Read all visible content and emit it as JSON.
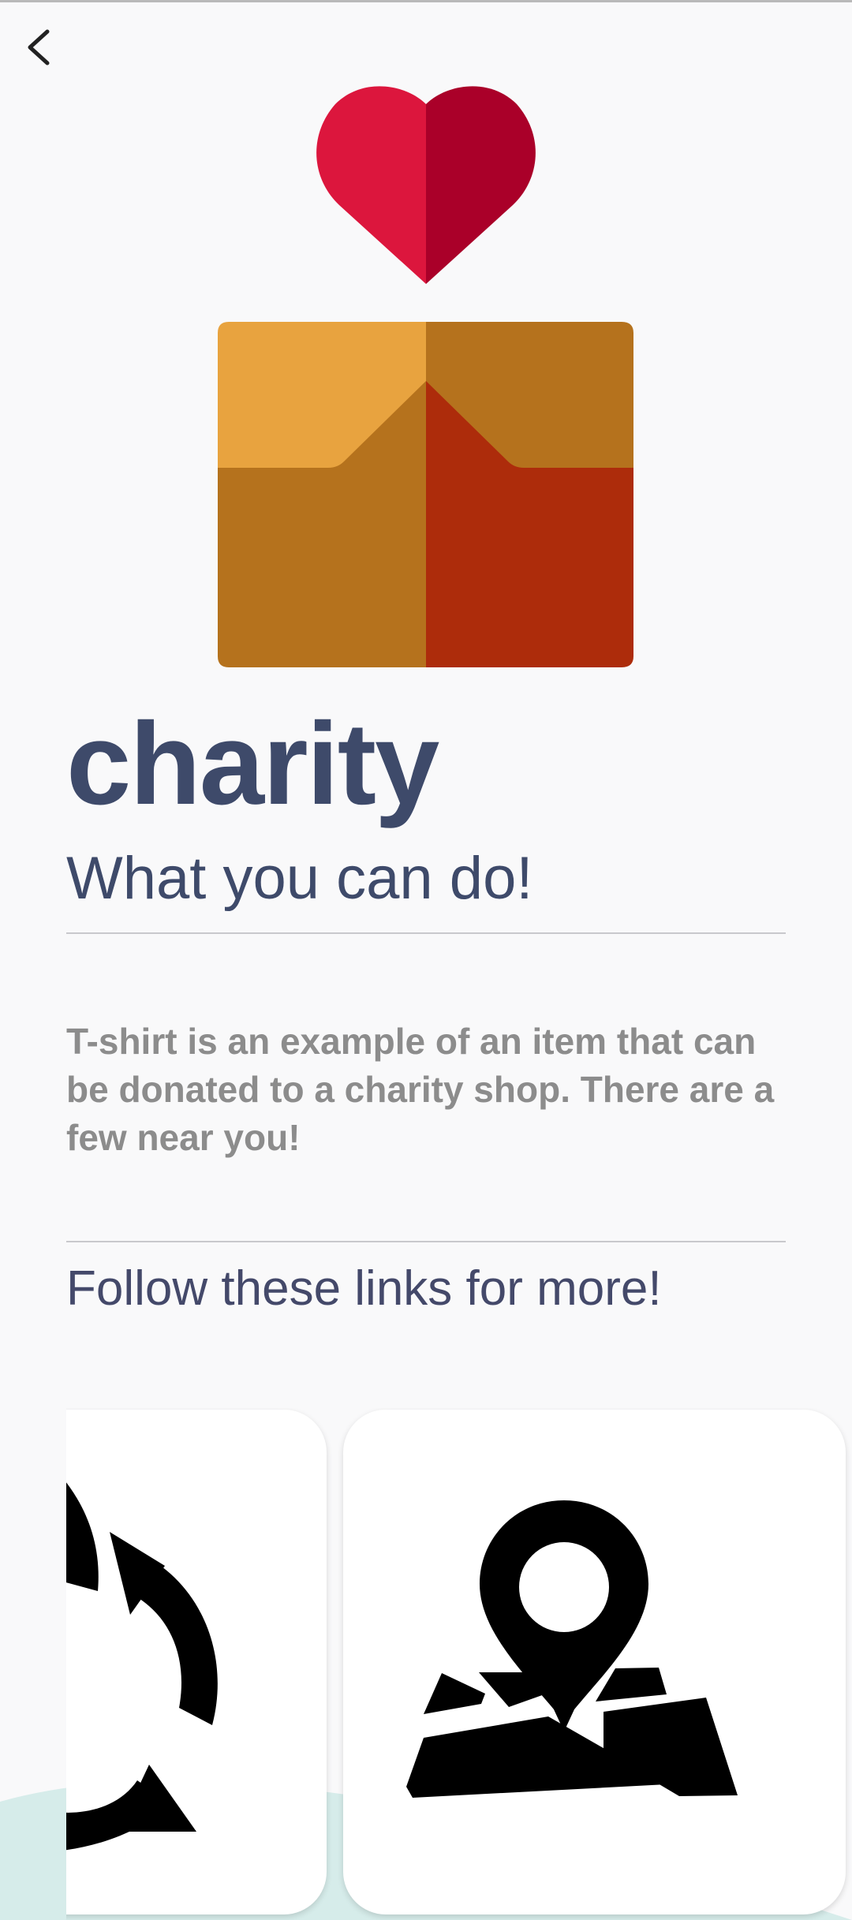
{
  "nav": {
    "back_icon": "chevron-left-icon"
  },
  "hero": {
    "heart_icon": "heart-icon",
    "box_icon": "donation-box-icon",
    "colors": {
      "heart_left": "#dc163d",
      "heart_right": "#aa0029",
      "box_top_left": "#e8a33f",
      "box_mid": "#b5721d",
      "box_bottom_right": "#ad2c0b"
    }
  },
  "title": "charity",
  "subtitle": "What you can do!",
  "description": "T-shirt is an example of an item that can be donated to a charity shop. There are a few near you!",
  "links_heading": "Follow these links for more!",
  "links": [
    {
      "icon": "recycle-icon"
    },
    {
      "icon": "map-pin-icon"
    }
  ],
  "colors": {
    "title": "#3e4a6a",
    "description": "#8c8c8c",
    "background": "#f9f9fa",
    "wave": "#d6ecea"
  }
}
